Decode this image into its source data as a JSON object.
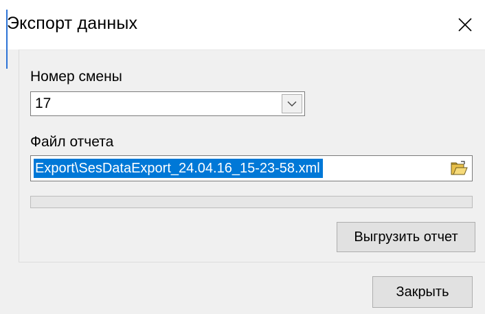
{
  "window": {
    "title": "Экспорт данных",
    "close_icon": "close-icon"
  },
  "shift": {
    "label": "Номер смены",
    "value": "17"
  },
  "report_file": {
    "label": "Файл отчета",
    "value": "Export\\SesDataExport_24.04.16_15-23-58.xml",
    "browse_icon": "open-folder-icon"
  },
  "progress": {
    "fraction": 0
  },
  "buttons": {
    "export_label": "Выгрузить отчет",
    "close_label": "Закрыть"
  },
  "colors": {
    "selection": "#0078d7",
    "title_accent": "#2b72d6"
  }
}
